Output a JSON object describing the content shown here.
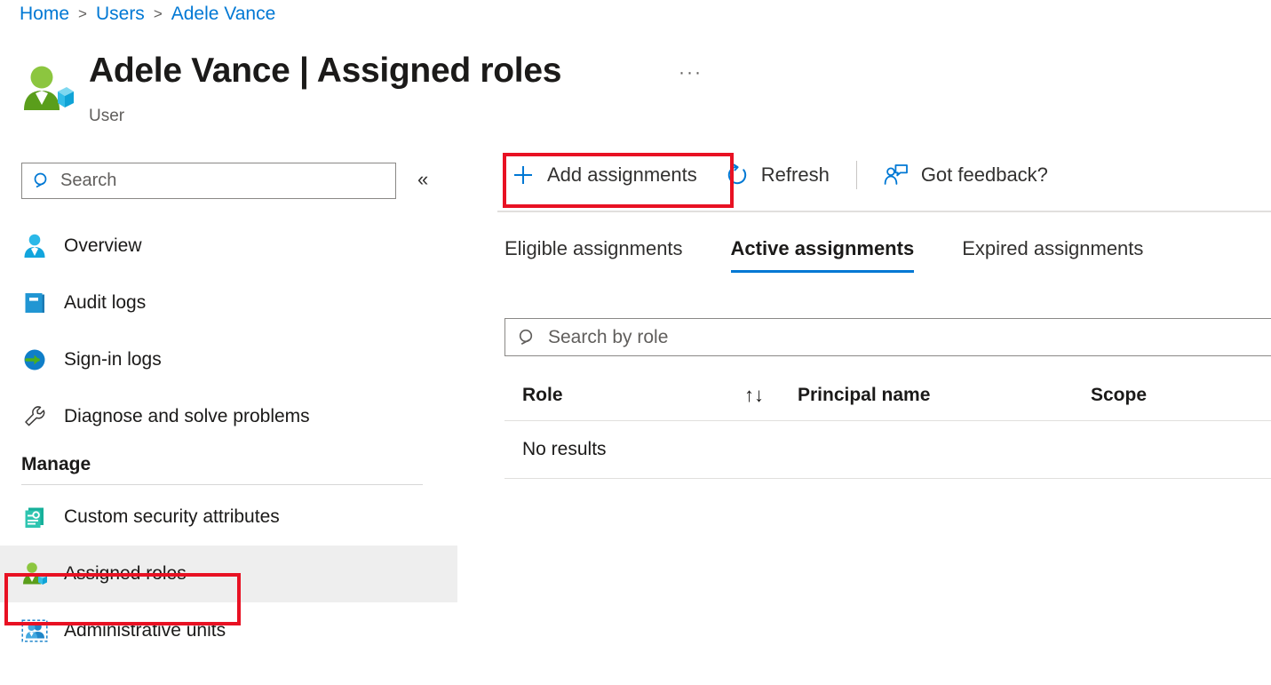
{
  "breadcrumb": {
    "items": [
      {
        "label": "Home"
      },
      {
        "label": "Users"
      },
      {
        "label": "Adele Vance"
      }
    ],
    "separator": ">"
  },
  "header": {
    "icon": "user-with-cube-icon",
    "title": "Adele Vance | Assigned roles",
    "subtitle": "User",
    "more_menu": "···"
  },
  "sidebar": {
    "search": {
      "placeholder": "Search",
      "icon": "search-icon"
    },
    "collapse_label": "«",
    "items": [
      {
        "label": "Overview",
        "icon": "user-blue-icon",
        "selected": false
      },
      {
        "label": "Audit logs",
        "icon": "book-icon",
        "selected": false
      },
      {
        "label": "Sign-in logs",
        "icon": "sign-in-arrow-icon",
        "selected": false
      },
      {
        "label": "Diagnose and solve problems",
        "icon": "wrench-icon",
        "selected": false
      }
    ],
    "manage": {
      "title": "Manage",
      "items": [
        {
          "label": "Custom security attributes",
          "icon": "document-gear-icon",
          "selected": false
        },
        {
          "label": "Assigned roles",
          "icon": "user-with-cube-green-icon",
          "selected": true
        },
        {
          "label": "Administrative units",
          "icon": "admin-units-icon",
          "selected": false
        }
      ]
    }
  },
  "toolbar": {
    "add_assignments": "Add assignments",
    "add_icon": "plus-icon",
    "refresh": "Refresh",
    "refresh_icon": "refresh-icon",
    "feedback": "Got feedback?",
    "feedback_icon": "person-feedback-icon"
  },
  "tabs": [
    {
      "label": "Eligible assignments",
      "active": false
    },
    {
      "label": "Active assignments",
      "active": true
    },
    {
      "label": "Expired assignments",
      "active": false
    }
  ],
  "role_search": {
    "placeholder": "Search by role",
    "icon": "search-icon"
  },
  "table": {
    "columns": [
      "Role",
      "Principal name",
      "Scope"
    ],
    "sort_icon": "↑↓",
    "rows": [],
    "empty_message": "No results"
  },
  "colors": {
    "accent_blue": "#0078d4",
    "highlight_red": "#e81123",
    "selected_bg": "#eeeeee",
    "text_primary": "#1b1a19",
    "text_secondary": "#605e5c",
    "border": "#8a8886"
  }
}
